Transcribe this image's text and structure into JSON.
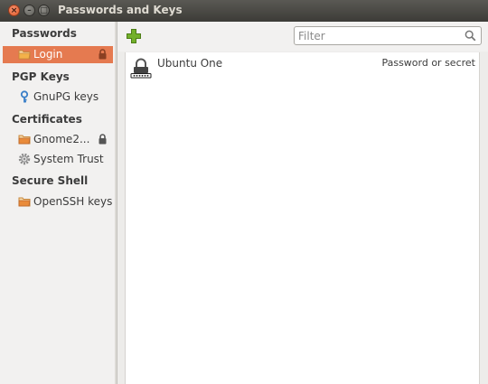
{
  "window": {
    "title": "Passwords and Keys",
    "close_glyph": "×",
    "min_glyph": "–",
    "max_glyph": "□"
  },
  "sidebar": {
    "sections": [
      {
        "label": "Passwords",
        "items": [
          {
            "label": "Login",
            "icon": "folder-icon",
            "locked": true,
            "selected": true
          }
        ]
      },
      {
        "label": "PGP Keys",
        "items": [
          {
            "label": "GnuPG keys",
            "icon": "key-icon"
          }
        ]
      },
      {
        "label": "Certificates",
        "items": [
          {
            "label": "Gnome2...",
            "icon": "folder-icon",
            "locked": true
          },
          {
            "label": "System Trust",
            "icon": "gear-icon"
          }
        ]
      },
      {
        "label": "Secure Shell",
        "items": [
          {
            "label": "OpenSSH keys",
            "icon": "folder-icon"
          }
        ]
      }
    ]
  },
  "toolbar": {
    "add_icon": "add-icon",
    "filter_placeholder": "Filter",
    "search_icon": "search-icon"
  },
  "list": {
    "rows": [
      {
        "name": "Ubuntu One",
        "type": "Password or secret",
        "icon": "password-lock-icon"
      }
    ]
  },
  "colors": {
    "selection": "#e57a50",
    "titlebar": "#3c3b37",
    "add_green": "#6aa31f"
  }
}
